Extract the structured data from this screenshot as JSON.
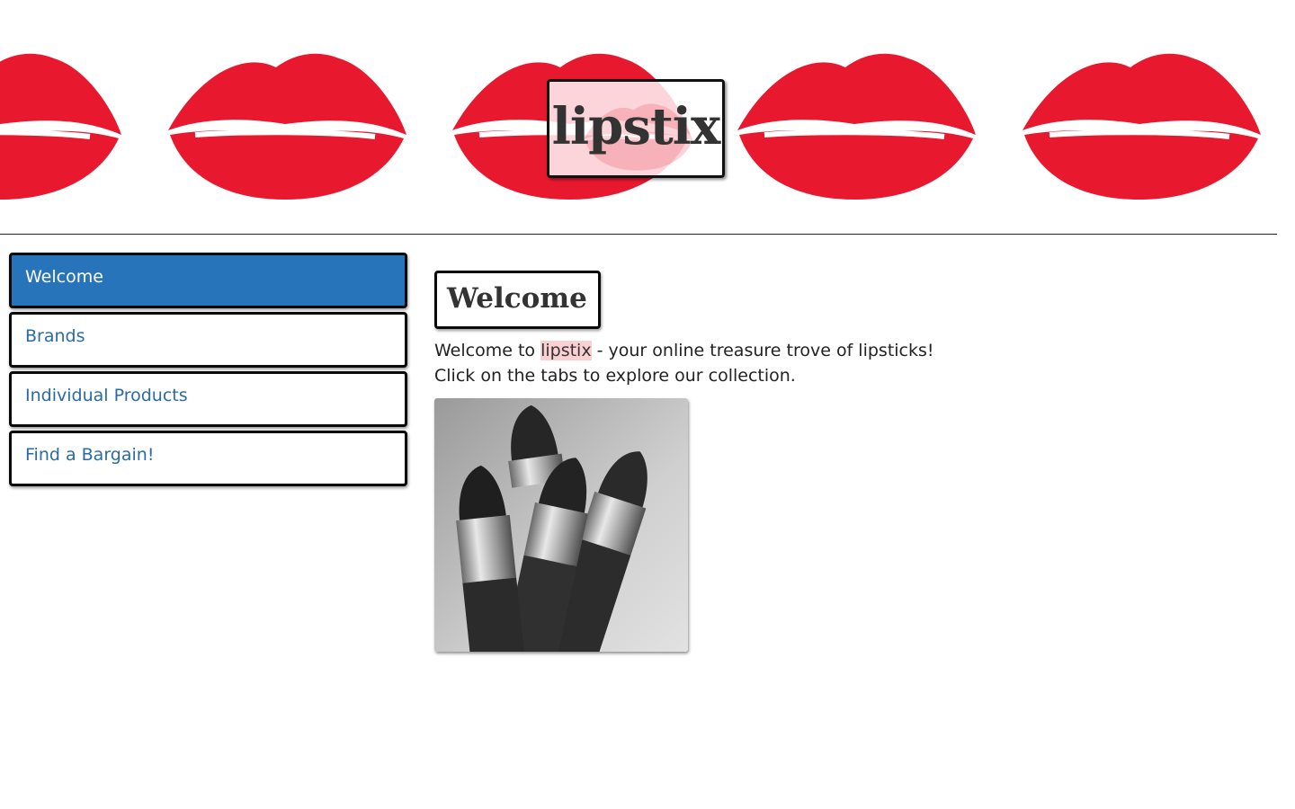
{
  "header": {
    "logo_text": "lipstix"
  },
  "nav": {
    "items": [
      {
        "label": "Welcome",
        "active": true
      },
      {
        "label": "Brands",
        "active": false
      },
      {
        "label": "Individual Products",
        "active": false
      },
      {
        "label": "Find a Bargain!",
        "active": false
      }
    ]
  },
  "main": {
    "title": "Welcome",
    "intro_before": "Welcome to ",
    "intro_brand": "lipstix",
    "intro_after": " - your online treasure trove of lipsticks!",
    "intro_line2": "Click on the tabs to explore our collection."
  },
  "colors": {
    "accent": "#2774ba",
    "link": "#2a6aa8",
    "lips": "#e8192f"
  },
  "icons": [
    "lips-print-icon",
    "lipstick-photo"
  ]
}
